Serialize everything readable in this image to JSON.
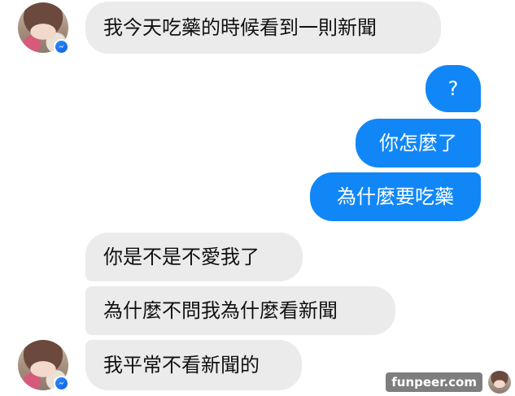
{
  "conversation": {
    "messages": [
      {
        "sender": "them",
        "text": "我今天吃藥的時候看到一則新聞"
      },
      {
        "sender": "me",
        "text": "?"
      },
      {
        "sender": "me",
        "text": "你怎麼了"
      },
      {
        "sender": "me",
        "text": "為什麼要吃藥"
      },
      {
        "sender": "them",
        "text": "你是不是不愛我了"
      },
      {
        "sender": "them",
        "text": "為什麼不問我為什麼看新聞"
      },
      {
        "sender": "them",
        "text": "我平常不看新聞的"
      }
    ]
  },
  "watermark": {
    "text": "funpeer.com"
  },
  "colors": {
    "outgoing_bubble": "#1187f7",
    "incoming_bubble": "#ebebeb",
    "messenger_badge": "#0f5fe0"
  },
  "icons": {
    "avatar": "contact-avatar",
    "badge": "messenger-icon"
  }
}
